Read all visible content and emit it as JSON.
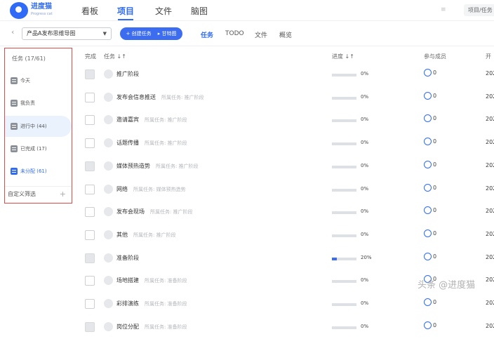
{
  "app": {
    "name": "进度猫",
    "sub": "Progress cat"
  },
  "nav": {
    "items": [
      "看板",
      "项目",
      "文件",
      "脑图"
    ],
    "active": "项目"
  },
  "top_right": {
    "button": "项目/任务"
  },
  "toolbar": {
    "project": "产品A发布思维导图",
    "create_task": "+ 创建任务",
    "gantt": "▸ 甘特图",
    "tabs": [
      "任务",
      "TODO",
      "文件",
      "概览"
    ],
    "active_tab": "任务"
  },
  "sidebar": {
    "title": "任务 (17/61)",
    "items": [
      {
        "label": "今天"
      },
      {
        "label": "我负责"
      },
      {
        "label": "进行中 (44)"
      },
      {
        "label": "已完成 (17)"
      },
      {
        "label": "未分配 (61)"
      }
    ],
    "custom_filter": "自定义筛选"
  },
  "table": {
    "headers": {
      "done": "完成",
      "task": "任务 ↓↑",
      "progress": "进度 ↓↑",
      "members": "参与成员",
      "start": "开"
    },
    "rows": [
      {
        "name": "推广阶段",
        "parent": "",
        "progress": 0,
        "progress_text": "0%",
        "members": "0",
        "date": "202",
        "done_gray": true
      },
      {
        "name": "发布会信息推送",
        "parent": "所属任务: 推广阶段",
        "progress": 0,
        "progress_text": "0%",
        "members": "0",
        "date": "202",
        "done_gray": false
      },
      {
        "name": "邀请嘉宾",
        "parent": "所属任务: 推广阶段",
        "progress": 0,
        "progress_text": "0%",
        "members": "0",
        "date": "202",
        "done_gray": false
      },
      {
        "name": "话题传播",
        "parent": "所属任务: 推广阶段",
        "progress": 0,
        "progress_text": "0%",
        "members": "0",
        "date": "202",
        "done_gray": false
      },
      {
        "name": "媒体预热造势",
        "parent": "所属任务: 推广阶段",
        "progress": 0,
        "progress_text": "0%",
        "members": "0",
        "date": "202",
        "done_gray": true
      },
      {
        "name": "网络",
        "parent": "所属任务: 媒体预热造势",
        "progress": 0,
        "progress_text": "0%",
        "members": "0",
        "date": "202",
        "done_gray": false
      },
      {
        "name": "发布会现场",
        "parent": "所属任务: 推广阶段",
        "progress": 0,
        "progress_text": "0%",
        "members": "0",
        "date": "202",
        "done_gray": false
      },
      {
        "name": "其他",
        "parent": "所属任务: 推广阶段",
        "progress": 0,
        "progress_text": "0%",
        "members": "0",
        "date": "202",
        "done_gray": false
      },
      {
        "name": "准备阶段",
        "parent": "",
        "progress": 20,
        "progress_text": "20%",
        "members": "0",
        "date": "202",
        "done_gray": true
      },
      {
        "name": "场地搭建",
        "parent": "所属任务: 准备阶段",
        "progress": 0,
        "progress_text": "0%",
        "members": "0",
        "date": "202",
        "done_gray": false
      },
      {
        "name": "彩排演练",
        "parent": "所属任务: 准备阶段",
        "progress": 0,
        "progress_text": "0%",
        "members": "0",
        "date": "202",
        "done_gray": false
      },
      {
        "name": "岗位分配",
        "parent": "所属任务: 准备阶段",
        "progress": 0,
        "progress_text": "0%",
        "members": "0",
        "date": "202",
        "done_gray": true
      }
    ]
  },
  "watermark": "头条 @进度猫",
  "colors": {
    "accent": "#2f6bf6",
    "highlight": "#e34b4b"
  }
}
